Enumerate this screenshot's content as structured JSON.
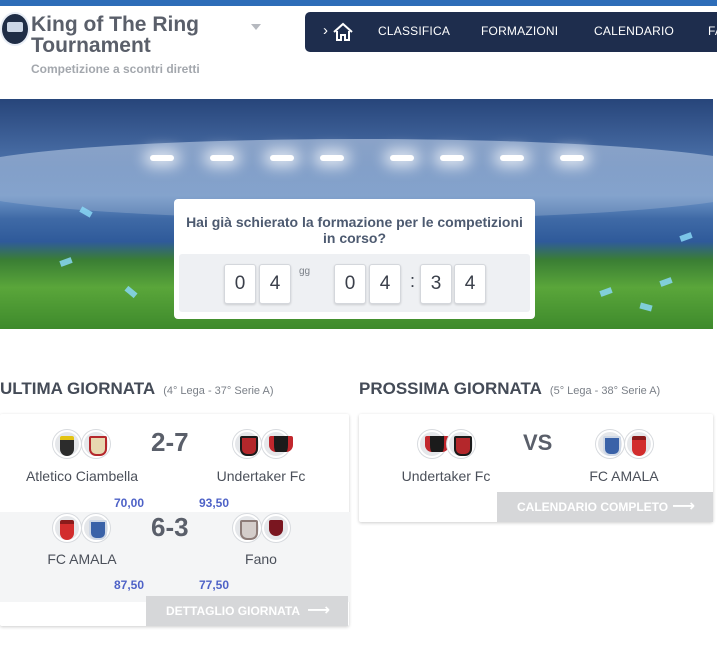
{
  "header": {
    "title": "King of The Ring Tournament",
    "subtitle": "Competizione a scontri diretti"
  },
  "nav": {
    "items": [
      "CLASSIFICA",
      "FORMAZIONI",
      "CALENDARIO",
      "FA"
    ]
  },
  "hero": {
    "question": "Hai già schierato la formazione per le competizioni in corso?",
    "countdown": {
      "days_digits": [
        "0",
        "4"
      ],
      "days_unit": "gg",
      "hours_digits": [
        "0",
        "4"
      ],
      "minutes_digits": [
        "3",
        "4"
      ],
      "separator": ":"
    }
  },
  "last_round": {
    "title": "ULTIMA GIORNATA",
    "subtitle": "(4° Lega - 37° Serie A)",
    "matches": [
      {
        "home": "Atletico Ciambella",
        "away": "Undertaker Fc",
        "score": "2-7",
        "home_pts": "70,00",
        "away_pts": "93,50"
      },
      {
        "home": "FC AMALA",
        "away": "Fano",
        "score": "6-3",
        "home_pts": "87,50",
        "away_pts": "77,50"
      }
    ],
    "button": "DETTAGLIO GIORNATA"
  },
  "next_round": {
    "title": "PROSSIMA GIORNATA",
    "subtitle": "(5° Lega - 38° Serie A)",
    "match": {
      "home": "Undertaker Fc",
      "away": "FC AMALA",
      "vs": "VS"
    },
    "button": "CALENDARIO COMPLETO"
  },
  "icons": {
    "home": "home-icon",
    "arrow_right": "arrow-right-icon",
    "chevron": "chevron-right-icon",
    "dropdown": "caret-down-icon"
  },
  "colors": {
    "nav_bg": "#1e2d4d",
    "points": "#4e62c7",
    "button_grey": "#d6d7d9"
  }
}
